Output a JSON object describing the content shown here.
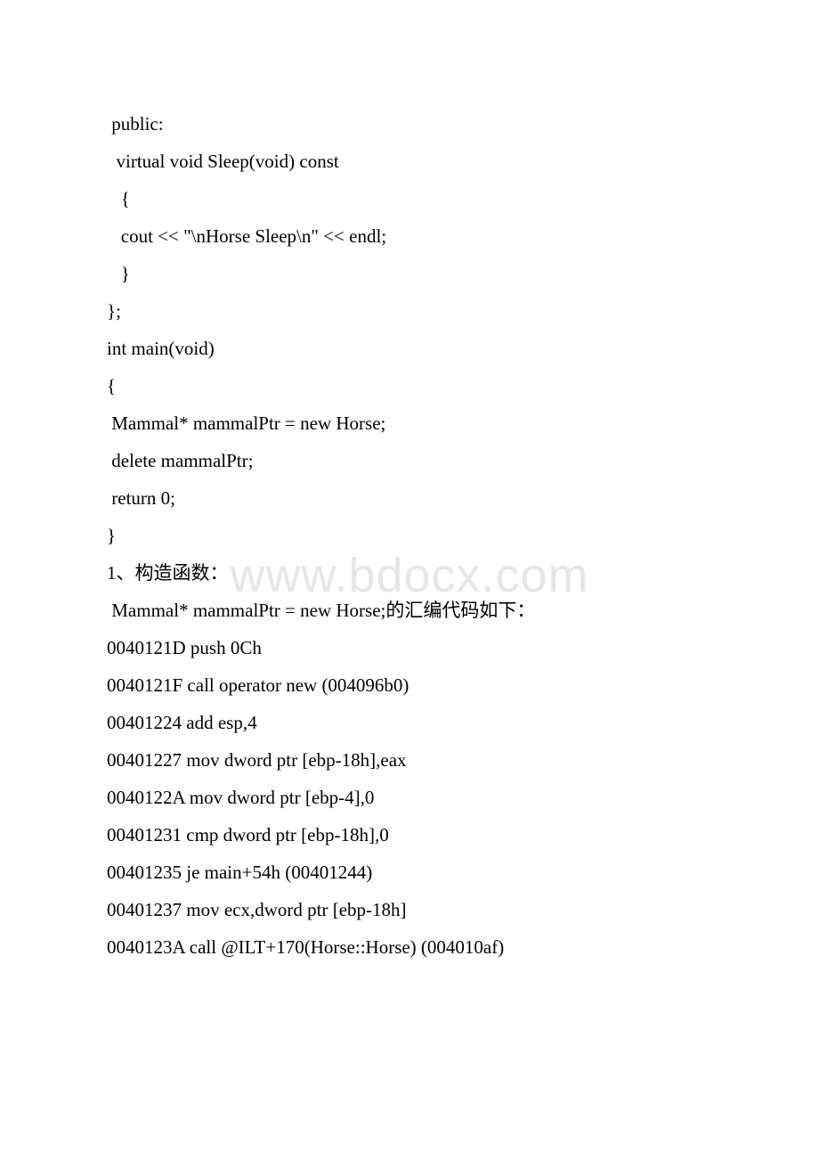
{
  "watermark": "www.bdocx.com",
  "lines": [
    " public:",
    "  virtual void Sleep(void) const",
    "   {",
    "   cout << \"\\nHorse Sleep\\n\" << endl;",
    "   }",
    "};",
    "int main(void)",
    "{",
    " Mammal* mammalPtr = new Horse;",
    "",
    " delete mammalPtr;",
    "",
    " return 0;",
    "}",
    "1、构造函数：",
    "",
    " Mammal* mammalPtr = new Horse;的汇编代码如下：",
    "0040121D push 0Ch",
    "0040121F call operator new (004096b0)",
    "00401224 add esp,4",
    "00401227 mov dword ptr [ebp-18h],eax",
    "0040122A mov dword ptr [ebp-4],0",
    "00401231 cmp dword ptr [ebp-18h],0",
    "00401235 je main+54h (00401244)",
    "00401237 mov ecx,dword ptr [ebp-18h]",
    "0040123A call @ILT+170(Horse::Horse) (004010af)"
  ]
}
